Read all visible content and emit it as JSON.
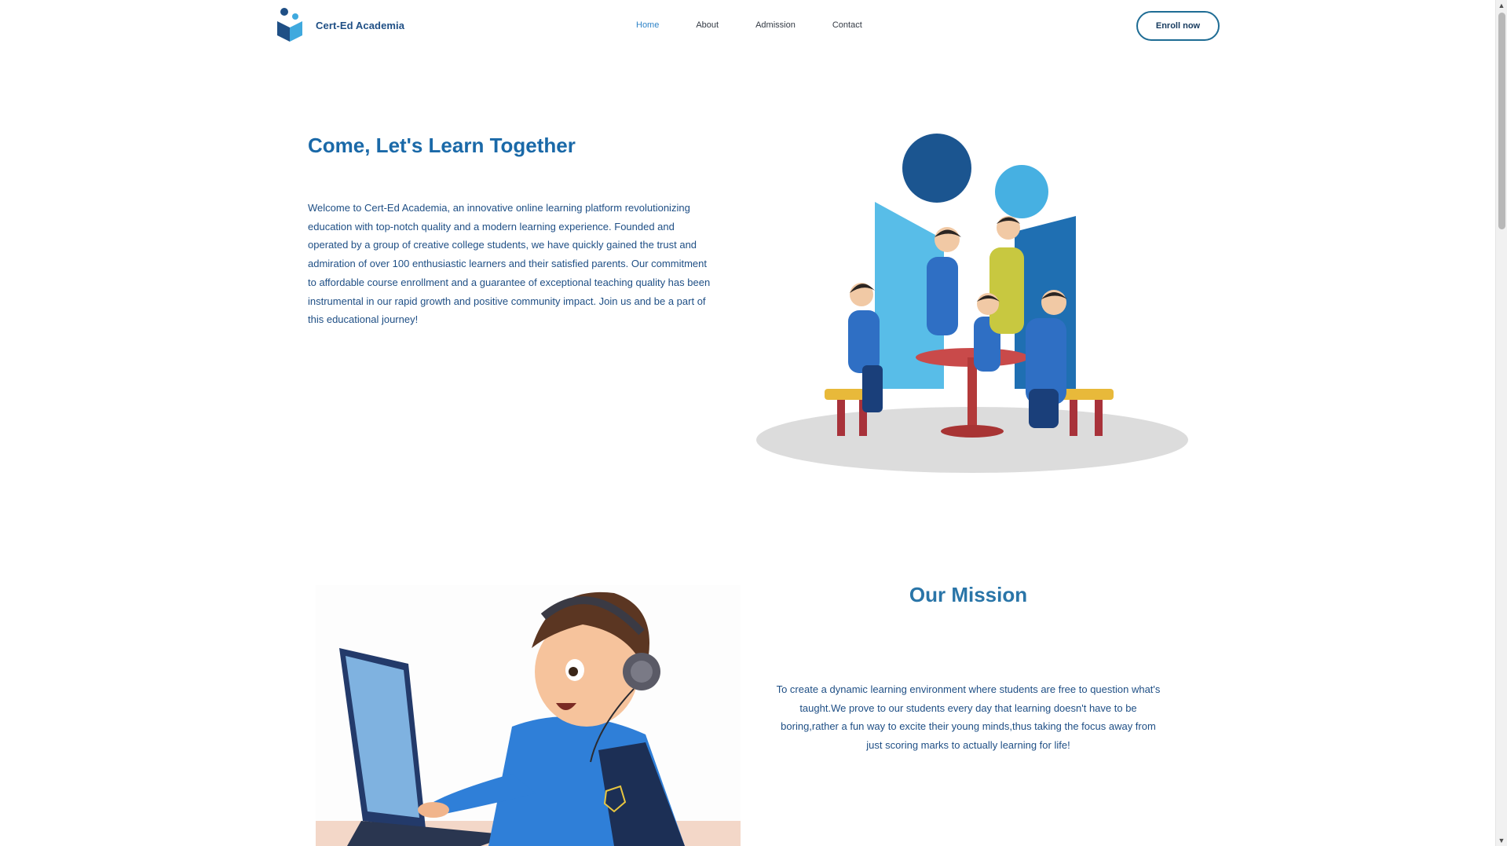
{
  "header": {
    "brand": "Cert-Ed Academia",
    "nav": [
      {
        "label": "Home",
        "active": true
      },
      {
        "label": "About",
        "active": false
      },
      {
        "label": "Admission",
        "active": false
      },
      {
        "label": "Contact",
        "active": false
      }
    ],
    "enroll_label": "Enroll now"
  },
  "hero": {
    "title": "Come, Let's Learn Together",
    "body": "Welcome to Cert-Ed Academia, an innovative online learning platform revolutionizing education with top-notch quality and a modern learning experience. Founded and operated by a group of creative college students, we have quickly gained the trust and admiration of over 100 enthusiastic learners and their satisfied parents. Our commitment to affordable course enrollment and a guarantee of exceptional teaching quality has been instrumental in our rapid growth and positive community impact. Join us and be a part of this educational journey!",
    "illustration": "family-at-table-illustration"
  },
  "mission": {
    "title": "Our Mission",
    "body": "To create a dynamic learning environment where students are free to question what's taught.We prove to our students every day that learning doesn't have to be boring,rather a fun way to excite their young minds,thus taking the focus away from just scoring marks to actually learning for life!",
    "illustration": "boy-with-laptop-illustration"
  },
  "colors": {
    "brand": "#1f4f85",
    "accent": "#2f84c8",
    "heading": "#1a69a8",
    "button_border": "#1e6c94"
  },
  "icons": {
    "logo": "book-people-logo-icon",
    "scroll_up": "scroll-up-arrow-icon",
    "scroll_down": "scroll-down-arrow-icon"
  }
}
